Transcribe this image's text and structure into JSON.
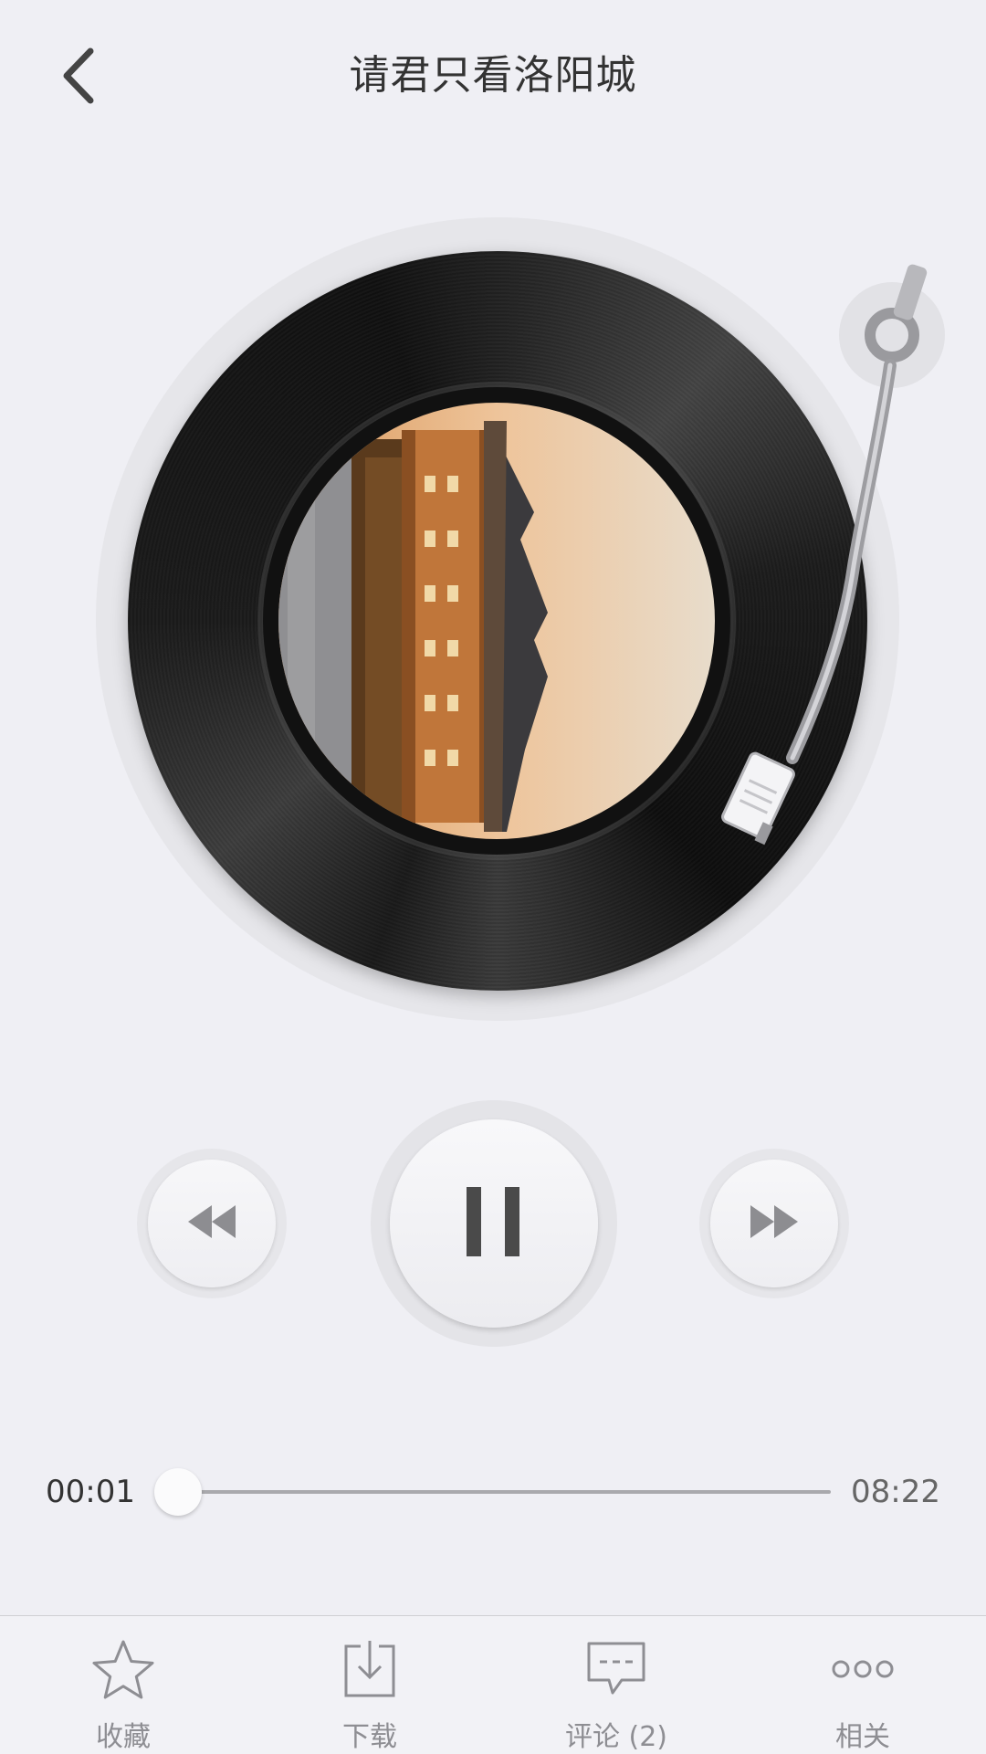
{
  "header": {
    "title": "请君只看洛阳城",
    "back_icon": "chevron-left-icon"
  },
  "player": {
    "state": "playing",
    "controls": {
      "prev_icon": "rewind-icon",
      "play_pause_icon": "pause-icon",
      "next_icon": "fast-forward-icon"
    },
    "progress": {
      "current_time": "00:01",
      "total_time": "08:22",
      "fraction": 0.002
    }
  },
  "bottom_bar": {
    "tabs": [
      {
        "label": "收藏",
        "icon": "star-icon"
      },
      {
        "label": "下载",
        "icon": "download-icon"
      },
      {
        "label": "评论 (2)",
        "icon": "comment-icon"
      },
      {
        "label": "相关",
        "icon": "more-icon"
      }
    ]
  },
  "colors": {
    "background": "#efeff4",
    "record": "#1a1a1a",
    "icon_gray": "#8e8e93",
    "control_dark": "#4a4a4a"
  }
}
